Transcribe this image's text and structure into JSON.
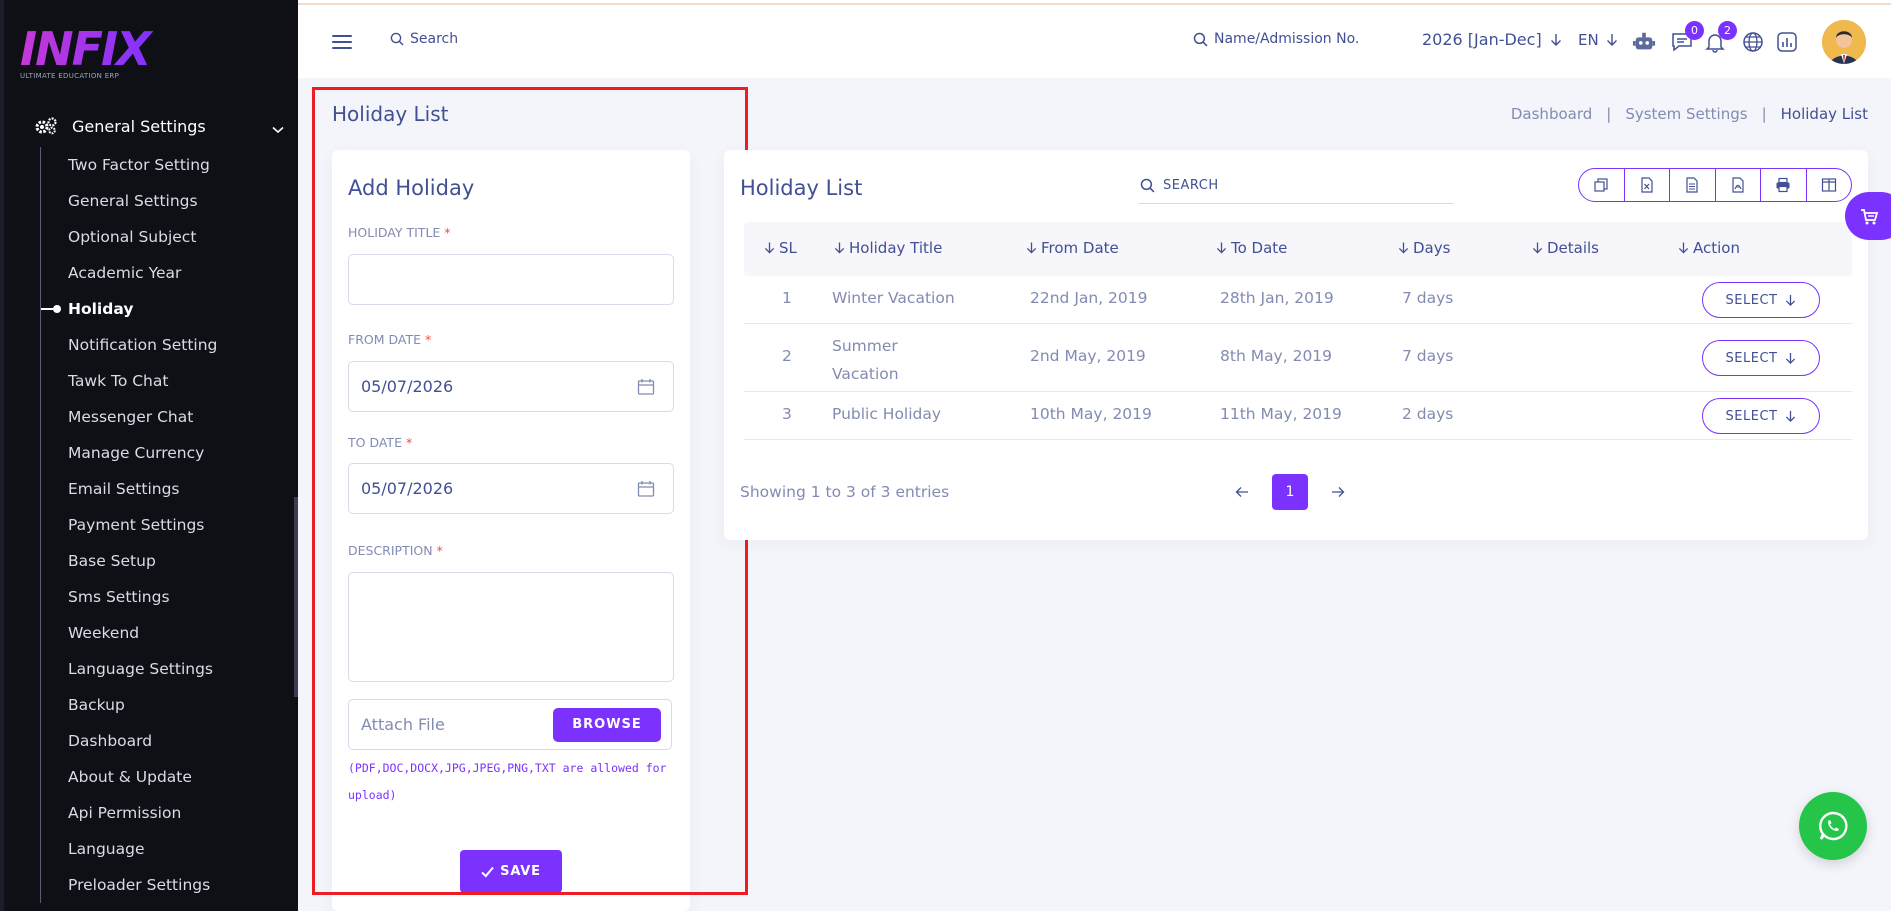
{
  "brand": {
    "logo_text": "INFIX",
    "logo_sub": "ULTIMATE EDUCATION ERP"
  },
  "sidebar": {
    "section_label": "General Settings",
    "items": [
      {
        "label": "Two Factor Setting"
      },
      {
        "label": "General Settings"
      },
      {
        "label": "Optional Subject"
      },
      {
        "label": "Academic Year"
      },
      {
        "label": "Holiday",
        "active": true
      },
      {
        "label": "Notification Setting"
      },
      {
        "label": "Tawk To Chat"
      },
      {
        "label": "Messenger Chat"
      },
      {
        "label": "Manage Currency"
      },
      {
        "label": "Email Settings"
      },
      {
        "label": "Payment Settings"
      },
      {
        "label": "Base Setup"
      },
      {
        "label": "Sms Settings"
      },
      {
        "label": "Weekend"
      },
      {
        "label": "Language Settings"
      },
      {
        "label": "Backup"
      },
      {
        "label": "Dashboard"
      },
      {
        "label": "About & Update"
      },
      {
        "label": "Api Permission"
      },
      {
        "label": "Language"
      },
      {
        "label": "Preloader Settings"
      }
    ]
  },
  "header": {
    "search_label": "Search",
    "student_search_label": "Name/Admission No.",
    "academic_year": "2026 [Jan-Dec]",
    "language": "EN",
    "chat_badge": "0",
    "notification_badge": "2"
  },
  "page": {
    "title": "Holiday List",
    "breadcrumb": [
      "Dashboard",
      "System Settings",
      "Holiday List"
    ]
  },
  "add_form": {
    "title": "Add Holiday",
    "holiday_title_label": "HOLIDAY TITLE",
    "holiday_title_value": "",
    "from_date_label": "FROM DATE",
    "from_date_value": "05/07/2026",
    "to_date_label": "TO DATE",
    "to_date_value": "05/07/2026",
    "description_label": "DESCRIPTION",
    "required_mark": "*",
    "attach_placeholder": "Attach File",
    "browse_label": "BROWSE",
    "file_hint": "(PDF,DOC,DOCX,JPG,JPEG,PNG,TXT are allowed for upload)",
    "save_label": "SAVE"
  },
  "list": {
    "title": "Holiday List",
    "search_placeholder": "SEARCH",
    "columns": [
      "SL",
      "Holiday Title",
      "From Date",
      "To Date",
      "Days",
      "Details",
      "Action"
    ],
    "rows": [
      {
        "sl": "1",
        "title": "Winter Vacation",
        "from": "22nd Jan, 2019",
        "to": "28th Jan, 2019",
        "days": "7 days",
        "details": "",
        "action": "SELECT"
      },
      {
        "sl": "2",
        "title": "Summer Vacation",
        "from": "2nd May, 2019",
        "to": "8th May, 2019",
        "days": "7 days",
        "details": "",
        "action": "SELECT"
      },
      {
        "sl": "3",
        "title": "Public Holiday",
        "from": "10th May, 2019",
        "to": "11th May, 2019",
        "days": "2 days",
        "details": "",
        "action": "SELECT"
      }
    ],
    "showing_text": "Showing 1 to 3 of 3 entries",
    "current_page": "1"
  },
  "colors": {
    "accent": "#7c32ff",
    "text": "#415094",
    "muted": "#828bb2",
    "sidebar_bg": "#0e1016",
    "highlight": "#ee1c24",
    "whatsapp": "#25c54a"
  }
}
